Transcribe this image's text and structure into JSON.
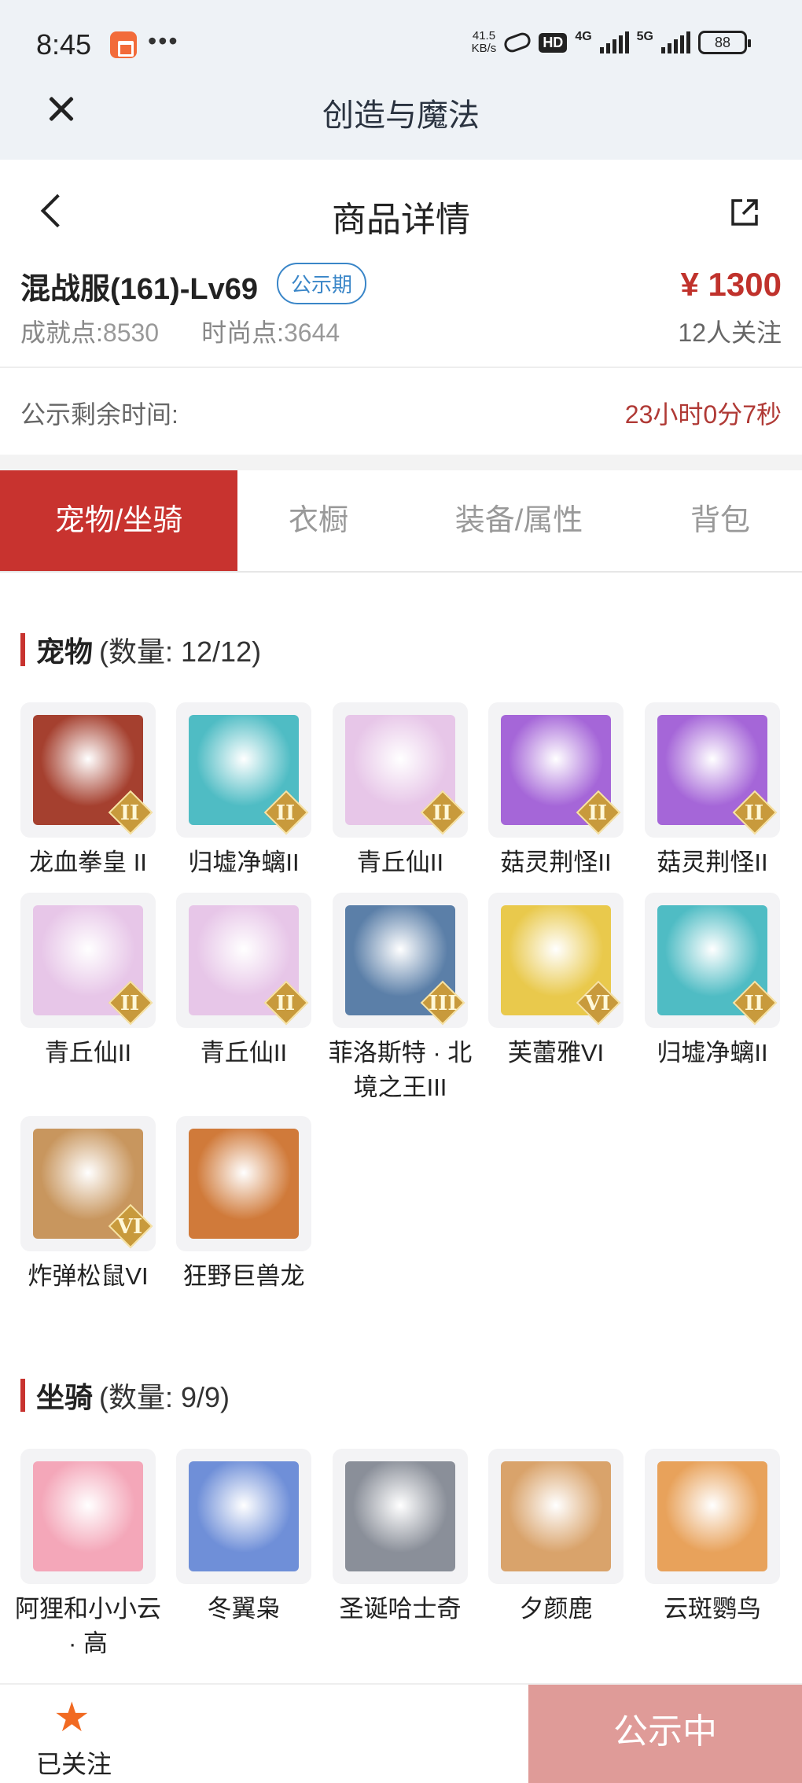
{
  "status_bar": {
    "time": "8:45",
    "speed_value": "41.5",
    "speed_unit": "KB/s",
    "hd": "HD",
    "net1": "4G",
    "net2": "5G",
    "battery": "88"
  },
  "app": {
    "title": "创造与魔法"
  },
  "page": {
    "title": "商品详情"
  },
  "product": {
    "name": "混战服(161)-Lv69",
    "badge": "公示期",
    "achievement_label": "成就点:",
    "achievement_value": "8530",
    "fashion_label": "时尚点:",
    "fashion_value": "3644",
    "price": "¥ 1300",
    "followers": "12人关注"
  },
  "timer": {
    "label": "公示剩余时间:",
    "value": "23小时0分7秒"
  },
  "tabs": [
    {
      "label": "宠物/坐骑",
      "active": true
    },
    {
      "label": "衣橱",
      "active": false
    },
    {
      "label": "装备/属性",
      "active": false
    },
    {
      "label": "背包",
      "active": false
    }
  ],
  "pets": {
    "title": "宠物",
    "count": "(数量: 12/12)",
    "items": [
      {
        "name": "龙血拳皇 II",
        "rank": "II",
        "color": "#a5402f"
      },
      {
        "name": "归墟净螭II",
        "rank": "II",
        "color": "#4fbcc4"
      },
      {
        "name": "青丘仙II",
        "rank": "II",
        "color": "#e7c6e8"
      },
      {
        "name": "菇灵荆怪II",
        "rank": "II",
        "color": "#a566d8"
      },
      {
        "name": "菇灵荆怪II",
        "rank": "II",
        "color": "#a566d8"
      },
      {
        "name": "青丘仙II",
        "rank": "II",
        "color": "#e7c6e8"
      },
      {
        "name": "青丘仙II",
        "rank": "II",
        "color": "#e7c6e8"
      },
      {
        "name": "菲洛斯特 · 北境之王III",
        "rank": "III",
        "color": "#5b7fa8"
      },
      {
        "name": "芙蕾雅VI",
        "rank": "VI",
        "color": "#e9c94c"
      },
      {
        "name": "归墟净螭II",
        "rank": "II",
        "color": "#4fbcc4"
      },
      {
        "name": "炸弹松鼠VI",
        "rank": "VI",
        "color": "#c8965e"
      },
      {
        "name": "狂野巨兽龙",
        "rank": "",
        "color": "#d07a3a"
      }
    ]
  },
  "mounts": {
    "title": "坐骑",
    "count": "(数量: 9/9)",
    "items": [
      {
        "name": "阿狸和小小云 · 高",
        "color": "#f4a7b9"
      },
      {
        "name": "冬翼枭",
        "color": "#6f8fd8"
      },
      {
        "name": "圣诞哈士奇",
        "color": "#8a8f99"
      },
      {
        "name": "夕颜鹿",
        "color": "#d9a36b"
      },
      {
        "name": "云斑鹦鸟",
        "color": "#e8a25b"
      }
    ]
  },
  "bottom": {
    "follow_label": "已关注",
    "cta_label": "公示中"
  }
}
